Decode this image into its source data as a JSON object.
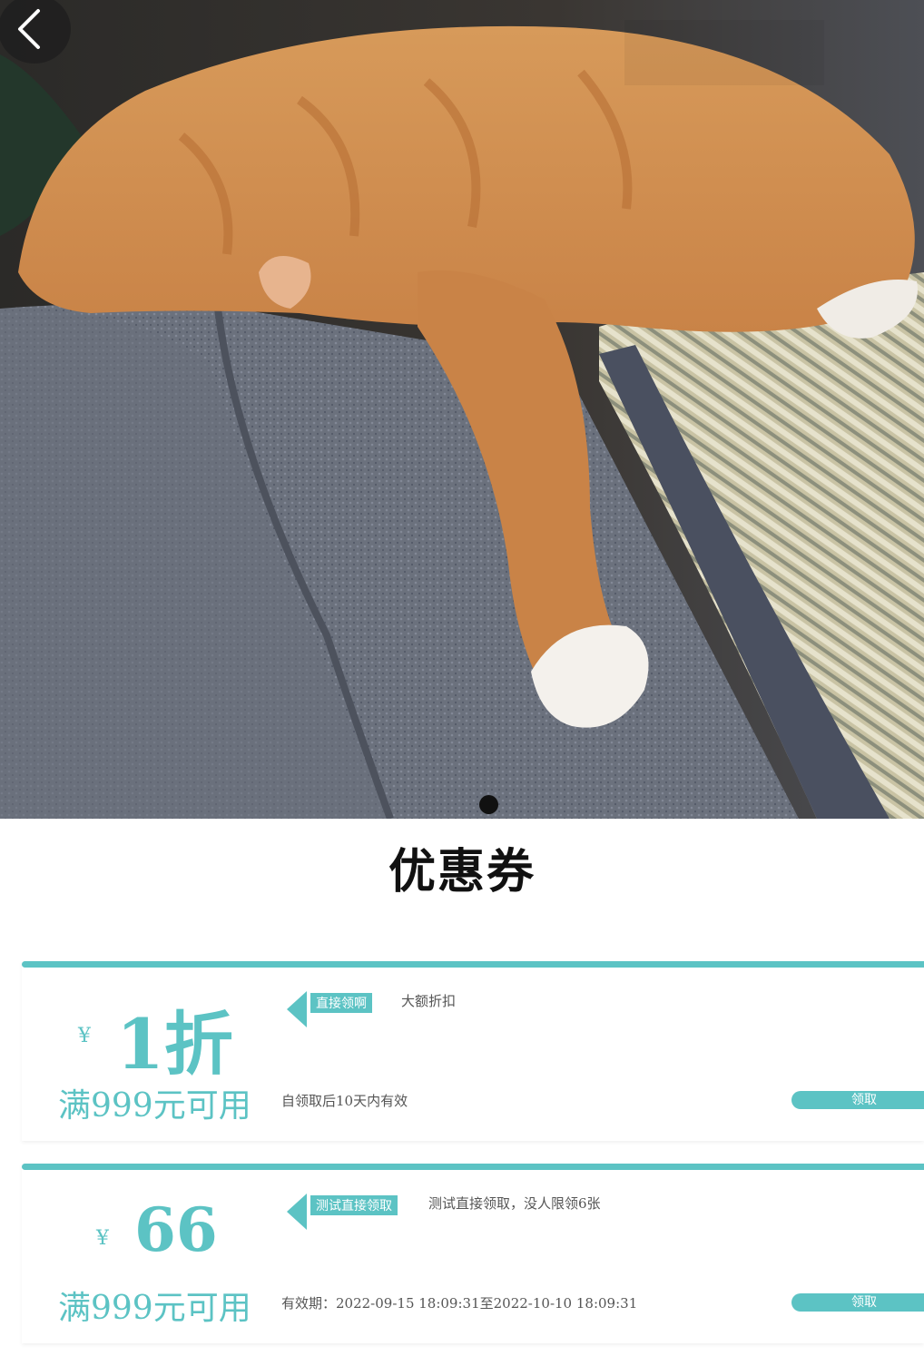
{
  "page": {
    "section_title": "优惠券"
  },
  "carousel": {
    "image_alt": "orange cat sleeping on grey sofa",
    "slide_count": 1,
    "active_index": 0
  },
  "coupons": [
    {
      "currency": "¥",
      "amount": "1折",
      "condition": "满999元可用",
      "tag": "直接领啊",
      "description": "大额折扣",
      "validity": "自领取后10天内有效",
      "claim_label": "领取"
    },
    {
      "currency": "¥",
      "amount": "66",
      "condition": "满999元可用",
      "tag": "测试直接领取",
      "description": "测试直接领取，没人限领6张",
      "validity": "有效期：2022-09-15 18:09:31至2022-10-10 18:09:31",
      "claim_label": "领取"
    }
  ],
  "colors": {
    "accent": "#5cc3c4",
    "title": "#111111",
    "muted_text": "#555555"
  }
}
